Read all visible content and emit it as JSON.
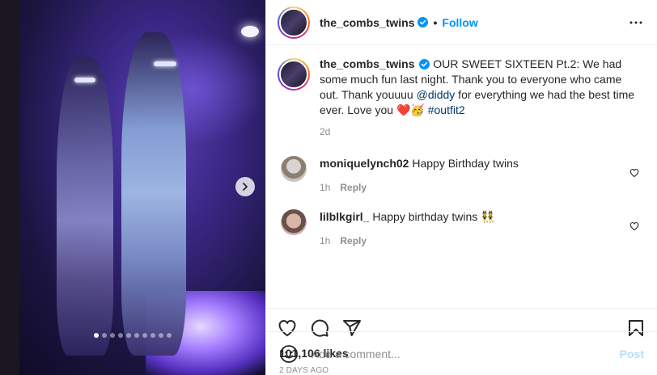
{
  "post": {
    "username": "the_combs_twins",
    "follow_label": "Follow",
    "separator": "•",
    "caption_text": " OUR SWEET SIXTEEN Pt.2: We had some much fun last night. Thank you to everyone who came out. Thank youuuu ",
    "caption_mention": "@diddy",
    "caption_text2": " for everything we had the best time ever. Love you ",
    "caption_emojis": "❤️🥳",
    "caption_hashtag": "#outfit2",
    "caption_age": "2d",
    "likes": "101,106 likes",
    "date": "2 DAYS AGO"
  },
  "comments": [
    {
      "username": "moniquelynch02",
      "text": "Happy Birthday twins",
      "age": "1h",
      "reply_label": "Reply"
    },
    {
      "username": "lilblkgirl_",
      "text": "Happy birthday twins 👯",
      "age": "1h",
      "reply_label": "Reply"
    }
  ],
  "add_comment": {
    "placeholder": "Add a comment...",
    "post_label": "Post"
  },
  "carousel": {
    "total": 10,
    "active_index": 0
  },
  "colors": {
    "accent": "#0095f6",
    "muted": "#8e8e8e",
    "post_disabled": "#b2dffc"
  },
  "icons": [
    "verified-icon",
    "more-icon",
    "chevron-right-icon",
    "heart-icon",
    "comment-icon",
    "share-icon",
    "bookmark-icon",
    "emoji-icon"
  ]
}
